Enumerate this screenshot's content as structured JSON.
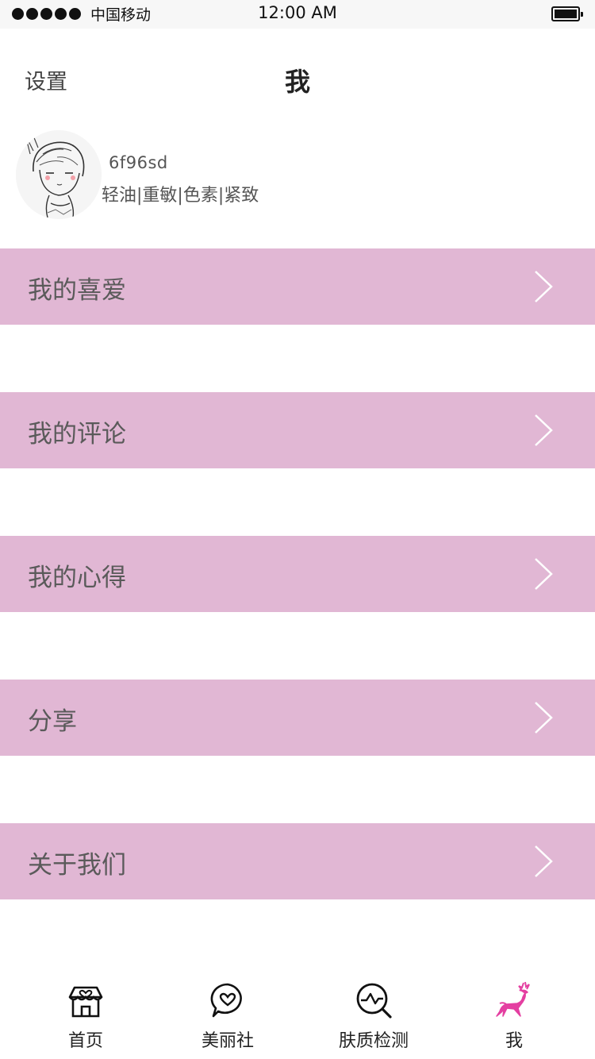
{
  "status_bar": {
    "carrier": "中国移动",
    "time": "12:00 AM"
  },
  "header": {
    "settings": "设置",
    "title": "我"
  },
  "profile": {
    "username": "6f96sd",
    "skin_tags": "轻油|重敏|色素|紧致"
  },
  "menu": [
    {
      "label": "我的喜爱"
    },
    {
      "label": "我的评论"
    },
    {
      "label": "我的心得"
    },
    {
      "label": "分享"
    },
    {
      "label": "关于我们"
    }
  ],
  "tab_bar": [
    {
      "label": "首页",
      "icon": "home-heart-icon"
    },
    {
      "label": "美丽社",
      "icon": "chat-heart-icon"
    },
    {
      "label": "肤质检测",
      "icon": "skin-test-icon"
    },
    {
      "label": "我",
      "icon": "deer-icon",
      "active": true
    }
  ],
  "colors": {
    "menu_bg": "#e1b7d4",
    "accent": "#e43fa1"
  }
}
